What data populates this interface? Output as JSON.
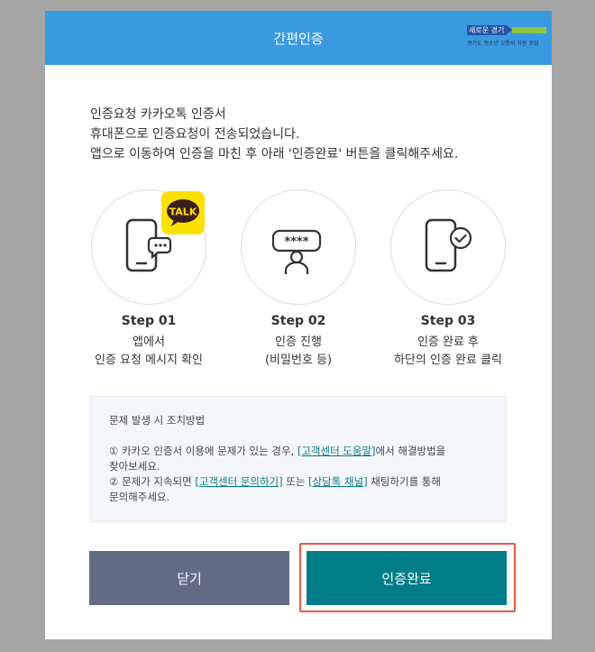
{
  "header": {
    "title": "간편인증"
  },
  "logo": {
    "badge": "새로운 경기",
    "subtitle": "경기도 청소년 교통비 지원 포털"
  },
  "intro": {
    "line1": "인증요청 카카오톡 인증서",
    "line2": "휴대폰으로 인증요청이 전송되었습니다.",
    "line3": "앱으로 이동하여 인증을 마친 후 아래 '인증완료' 버튼을 클릭해주세요."
  },
  "steps": [
    {
      "title": "Step 01",
      "line1": "앱에서",
      "line2": "인증 요청 메시지 확인",
      "badge": "TALK",
      "icon": "phone-chat-icon"
    },
    {
      "title": "Step 02",
      "line1": "인증 진행",
      "line2": "(비밀번호 등)",
      "icon": "password-user-icon"
    },
    {
      "title": "Step 03",
      "line1": "인증 완료 후",
      "line2": "하단의 인증 완료 클릭",
      "icon": "phone-check-icon"
    }
  ],
  "notice": {
    "title": "문제 발생 시 조치방법",
    "item1_prefix": "① 카카오 인증서 이용에 문제가 있는 경우, ",
    "item1_link": "[고객센터 도움말]",
    "item1_suffix": "에서 해결방법을",
    "item1_line2": "찾아보세요.",
    "item2_prefix": "② 문제가 지속되면 ",
    "item2_link1": "[고객센터 문의하기]",
    "item2_mid": " 또는 ",
    "item2_link2": "[상담톡 채널]",
    "item2_suffix": " 채팅하기를 통해",
    "item2_line2": "문의해주세요."
  },
  "buttons": {
    "close": "닫기",
    "done": "인증완료"
  },
  "colors": {
    "header": "#3a9ae0",
    "close_button": "#626b85",
    "done_button": "#007d87",
    "highlight": "#e45949",
    "kakao": "#fae100",
    "link": "#0a7c82"
  }
}
